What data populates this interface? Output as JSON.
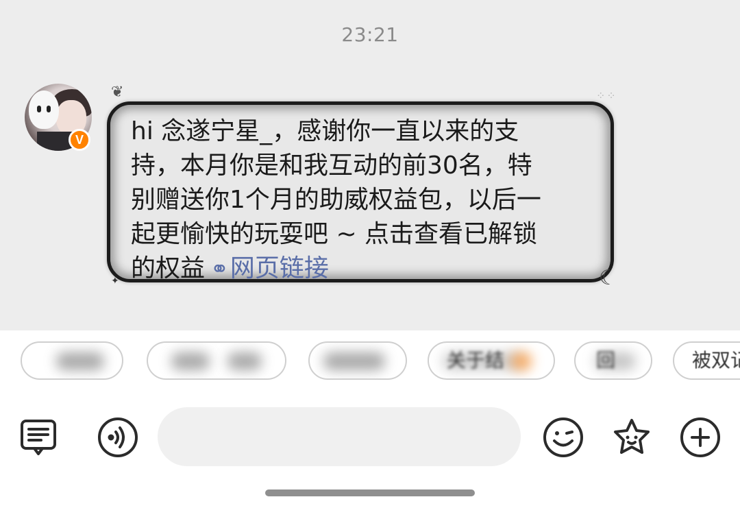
{
  "chat": {
    "timestamp": "23:21",
    "sender_badge": "V",
    "message": {
      "lines": [
        "hi 念遂宁星_，感谢你一直以来的支",
        "持，本月你是和我互动的前30名，特",
        "别赠送你1个月的助威权益包，以后一",
        "起更愉快的玩耍吧 ~ 点击查看已解锁",
        "的权益"
      ],
      "link_label": "网页链接",
      "link_icon": "link-icon"
    }
  },
  "quick_replies": [
    {
      "label": ""
    },
    {
      "label": ""
    },
    {
      "label": ""
    },
    {
      "label": "关于结"
    },
    {
      "label": "回"
    },
    {
      "label": "被双记"
    }
  ],
  "toolbar": {
    "input_placeholder": "",
    "icons": [
      "message-list-icon",
      "voice-icon",
      "emoji-icon",
      "star-sticker-icon",
      "add-icon"
    ]
  },
  "colors": {
    "chat_background": "#ededed",
    "link": "#5a6ea8",
    "badge": "#ff8200"
  }
}
